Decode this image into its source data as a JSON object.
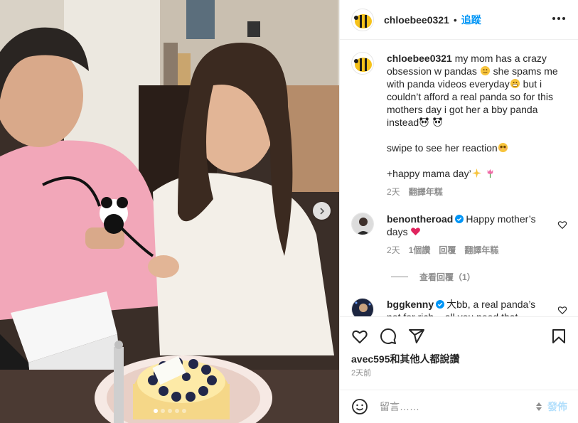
{
  "post": {
    "username": "chloebee0321",
    "separator": "•",
    "follow_label": "追蹤",
    "more_icon": "more-horizontal-icon",
    "carousel": {
      "total_slides": 5,
      "active_slide": 1
    }
  },
  "caption": {
    "username": "chloebee0321",
    "p1_a": "my mom has a crazy obsession w pandas",
    "p1_b": " she spams me with panda videos everyday",
    "p1_c": " but i couldn’t afford a real panda so for this mothers day i got her a bby panda instead",
    "p2": "swipe to see her reaction",
    "p3": "+happy mama day’",
    "time": "2天",
    "translate": "翻譯年糕"
  },
  "comments": [
    {
      "username": "benontheroad",
      "text": "Happy mother’s days",
      "time": "2天",
      "likes": "1個讚",
      "reply": "回覆",
      "translate": "翻譯年糕"
    },
    {
      "username": "bggkenny",
      "text": "大bb, a real panda’s not for rich ,, all you need that",
      "time": "",
      "likes": "",
      "reply": "",
      "translate": ""
    }
  ],
  "view_replies": "查看回覆（1）",
  "actions": {
    "likes_text": "avec595和其他人都說讚",
    "posted_time": "2天前"
  },
  "composer": {
    "placeholder": "留言……",
    "submit_label": "發佈"
  },
  "colors": {
    "accent": "#0095f6",
    "text": "#262626",
    "secondary": "#8e8e8e",
    "border": "#efefef",
    "submit_disabled": "#b2dffc"
  }
}
